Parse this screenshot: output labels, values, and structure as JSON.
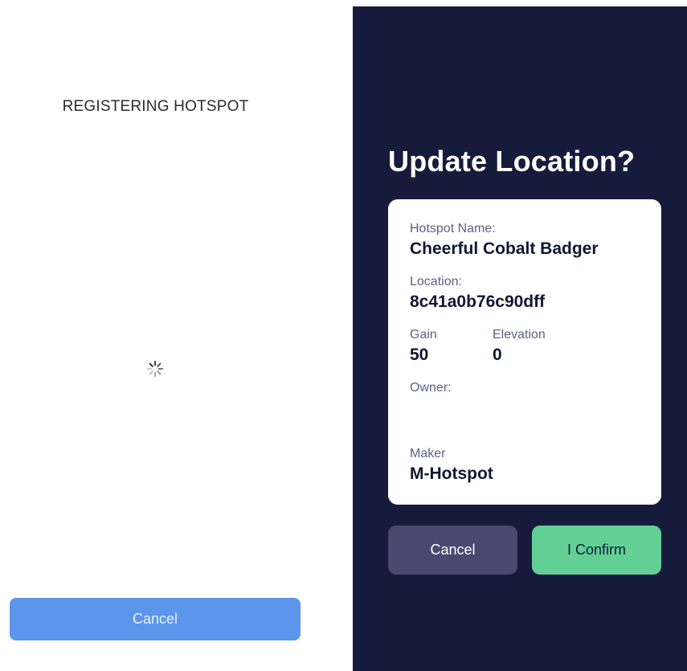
{
  "left_screen": {
    "title": "REGISTERING HOTSPOT",
    "cancel_label": "Cancel"
  },
  "right_screen": {
    "title": "Update Location?",
    "card": {
      "hotspot_name_label": "Hotspot Name:",
      "hotspot_name_value": "Cheerful Cobalt Badger",
      "location_label": "Location:",
      "location_value": "8c41a0b76c90dff",
      "gain_label": "Gain",
      "gain_value": "50",
      "elevation_label": "Elevation",
      "elevation_value": "0",
      "owner_label": "Owner:",
      "owner_value": "",
      "maker_label": "Maker",
      "maker_value": "M-Hotspot"
    },
    "cancel_label": "Cancel",
    "confirm_label": "I Confirm"
  },
  "colors": {
    "left_cancel_bg": "#5c95ec",
    "right_bg": "#171b3b",
    "right_cancel_bg": "#474a6e",
    "confirm_bg": "#62d094"
  },
  "icons": {
    "spinner": "loading-spinner-icon"
  }
}
